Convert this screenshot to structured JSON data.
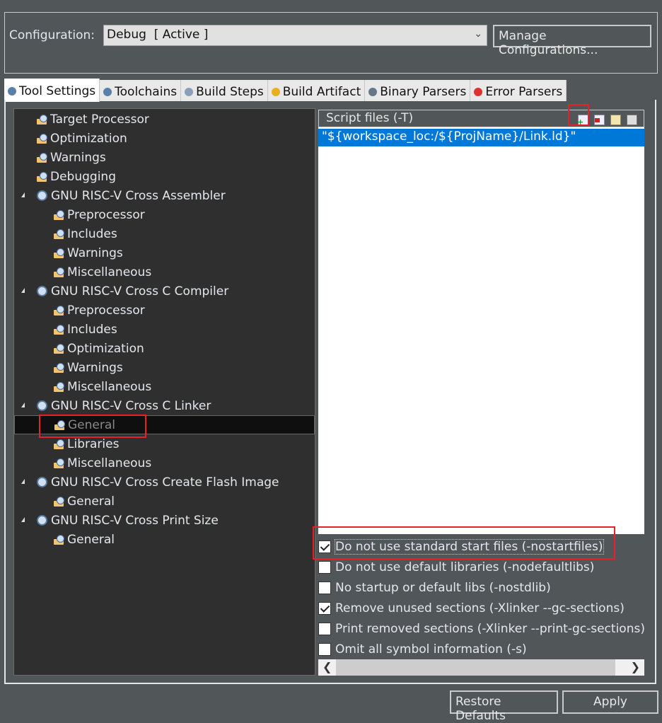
{
  "config": {
    "label": "Configuration:",
    "value": "Debug  [ Active ]",
    "manage_label": "Manage Configurations..."
  },
  "tabs": [
    {
      "label": "Tool Settings",
      "icon": "tool-settings-icon",
      "color": "#5a7fa8"
    },
    {
      "label": "Toolchains",
      "icon": "toolchains-icon",
      "color": "#5a7fa8"
    },
    {
      "label": "Build Steps",
      "icon": "build-steps-icon",
      "color": "#8aa0b8"
    },
    {
      "label": "Build Artifact",
      "icon": "build-artifact-icon",
      "color": "#e8b020"
    },
    {
      "label": "Binary Parsers",
      "icon": "binary-parsers-icon",
      "color": "#667788"
    },
    {
      "label": "Error Parsers",
      "icon": "error-parsers-icon",
      "color": "#e03030"
    }
  ],
  "tree": [
    {
      "label": "Target Processor",
      "level": 1
    },
    {
      "label": "Optimization",
      "level": 1
    },
    {
      "label": "Warnings",
      "level": 1
    },
    {
      "label": "Debugging",
      "level": 1
    },
    {
      "label": "GNU RISC-V Cross Assembler",
      "level": 0
    },
    {
      "label": "Preprocessor",
      "level": 2
    },
    {
      "label": "Includes",
      "level": 2
    },
    {
      "label": "Warnings",
      "level": 2
    },
    {
      "label": "Miscellaneous",
      "level": 2
    },
    {
      "label": "GNU RISC-V Cross C Compiler",
      "level": 0
    },
    {
      "label": "Preprocessor",
      "level": 2
    },
    {
      "label": "Includes",
      "level": 2
    },
    {
      "label": "Optimization",
      "level": 2
    },
    {
      "label": "Warnings",
      "level": 2
    },
    {
      "label": "Miscellaneous",
      "level": 2
    },
    {
      "label": "GNU RISC-V Cross C Linker",
      "level": 0
    },
    {
      "label": "General",
      "level": 2,
      "selected": true
    },
    {
      "label": "Libraries",
      "level": 2
    },
    {
      "label": "Miscellaneous",
      "level": 2
    },
    {
      "label": "GNU RISC-V Cross Create Flash Image",
      "level": 0
    },
    {
      "label": "General",
      "level": 2
    },
    {
      "label": "GNU RISC-V Cross Print Size",
      "level": 0
    },
    {
      "label": "General",
      "level": 2
    }
  ],
  "script_files": {
    "header": "Script files (-T)",
    "items": [
      "\"${workspace_loc:/${ProjName}/Link.ld}\""
    ]
  },
  "options": [
    {
      "label": "Do not use standard start files (-nostartfiles)",
      "checked": true
    },
    {
      "label": "Do not use default libraries (-nodefaultlibs)",
      "checked": false
    },
    {
      "label": "No startup or default libs (-nostdlib)",
      "checked": false
    },
    {
      "label": "Remove unused sections (-Xlinker --gc-sections)",
      "checked": true
    },
    {
      "label": "Print removed sections (-Xlinker --print-gc-sections)",
      "checked": false
    },
    {
      "label": "Omit all symbol information (-s)",
      "checked": false
    }
  ],
  "buttons": {
    "restore": "Restore Defaults",
    "apply": "Apply"
  },
  "colors": {
    "highlight": "#e8202a",
    "selection": "#0078d7"
  }
}
